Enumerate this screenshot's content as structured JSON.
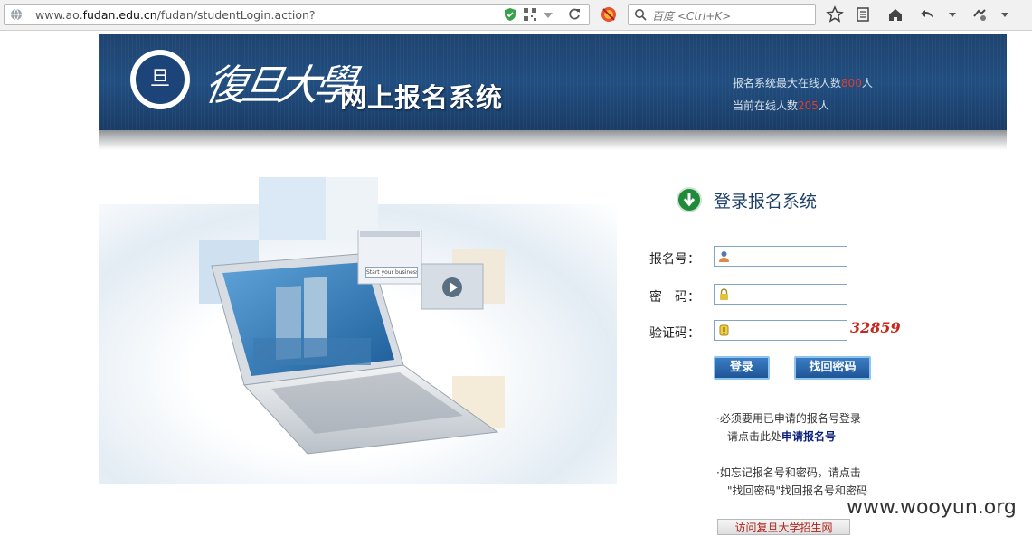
{
  "browser": {
    "url_plain": "www.ao.",
    "url_domain": "fudan.edu.cn",
    "url_path": "/fudan/studentLogin.action?",
    "search_placeholder": "百度 <Ctrl+K>"
  },
  "header": {
    "university_calligraphy": "復旦大學",
    "system_title": "网上报名系统",
    "max_online_prefix": "报名系统最大在线人数",
    "max_online_value": "800",
    "max_online_suffix": "人",
    "current_online_prefix": "当前在线人数",
    "current_online_value": "205",
    "current_online_suffix": "人"
  },
  "hero": {
    "screen_search_text": "Start your business"
  },
  "login": {
    "title": "登录报名系统",
    "username_label": "报名号：",
    "password_label": "密　码：",
    "captcha_label": "验证码：",
    "captcha_value": "32859",
    "login_button": "登录",
    "recover_button": "找回密码",
    "note1_line1": "·必须要用已申请的报名号登录",
    "note1_line2_prefix": "请点击此处",
    "note1_link": "申请报名号",
    "note2_line1": "·如忘记报名号和密码，请点击",
    "note2_line2": "\"找回密码\"找回报名号和密码",
    "visit_button": "访问复旦大学招生网"
  },
  "watermark": "www.wooyun.org",
  "colors": {
    "header_blue": "#214e80",
    "online_red": "#e33b2e",
    "button_blue": "#2a67ad",
    "captcha_red": "#c8261b"
  }
}
